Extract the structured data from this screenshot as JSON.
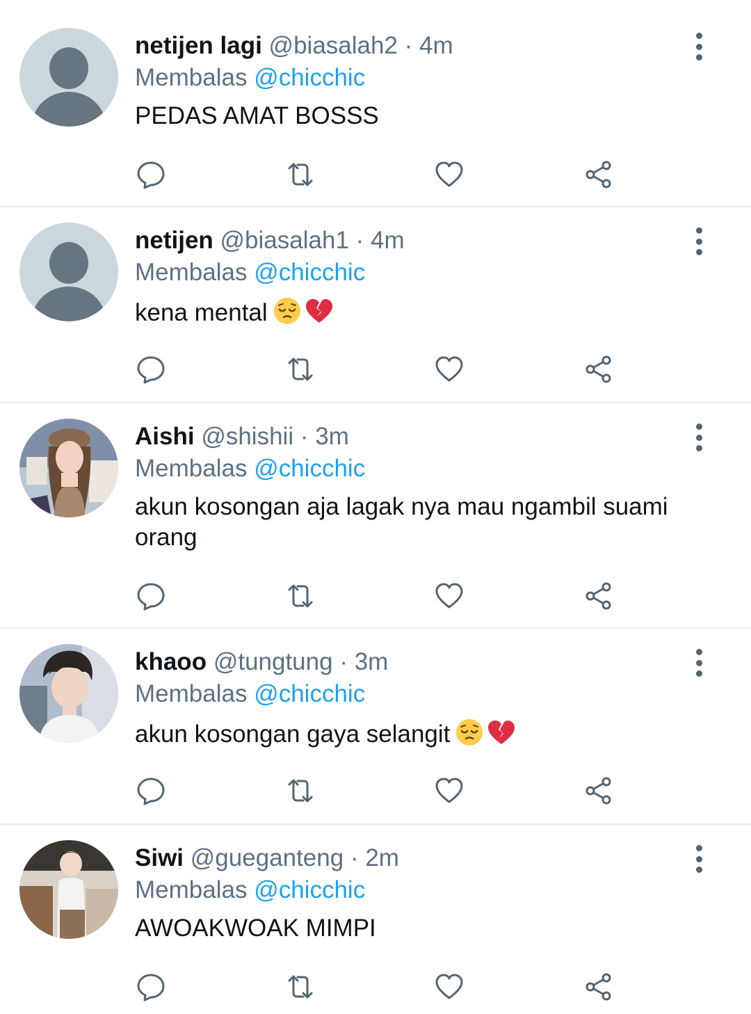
{
  "tweets": [
    {
      "name": "netijen lagi",
      "handle": "@biasalah2",
      "separator": "·",
      "time": "4m",
      "reply_prefix": "Membalas",
      "reply_to": "@chicchic",
      "text": "PEDAS AMAT BOSSS",
      "emojis": [],
      "avatar": "default-avatar"
    },
    {
      "name": "netijen",
      "handle": "@biasalah1",
      "separator": "·",
      "time": "4m",
      "reply_prefix": "Membalas",
      "reply_to": "@chicchic",
      "text": "kena mental",
      "emojis": [
        "pensive-face",
        "broken-heart"
      ],
      "avatar": "default-avatar"
    },
    {
      "name": "Aishi",
      "handle": "@shishii",
      "separator": "·",
      "time": "3m",
      "reply_prefix": "Membalas",
      "reply_to": "@chicchic",
      "text": "akun kosongan aja lagak nya mau ngambil suami orang",
      "emojis": [],
      "avatar": "photo-avatar"
    },
    {
      "name": "khaoo",
      "handle": "@tungtung",
      "separator": "·",
      "time": "3m",
      "reply_prefix": "Membalas",
      "reply_to": "@chicchic",
      "text": "akun kosongan gaya selangit",
      "emojis": [
        "pensive-face",
        "broken-heart"
      ],
      "avatar": "photo-avatar"
    },
    {
      "name": "Siwi",
      "handle": "@gueganteng",
      "separator": "·",
      "time": "2m",
      "reply_prefix": "Membalas",
      "reply_to": "@chicchic",
      "text": "AWOAKWOAK MIMPI",
      "emojis": [],
      "avatar": "photo-avatar"
    }
  ],
  "icons": {
    "reply": "reply-icon",
    "retweet": "retweet-icon",
    "like": "like-icon",
    "share": "share-icon",
    "more": "more-options-icon"
  },
  "colors": {
    "name": "#0f1419",
    "meta": "#5b7083",
    "mention": "#1da1f2",
    "icon": "#536471",
    "divider": "#e6ecf0",
    "default_avatar_bg": "#ccd6dd",
    "default_avatar_fg": "#66757f"
  }
}
